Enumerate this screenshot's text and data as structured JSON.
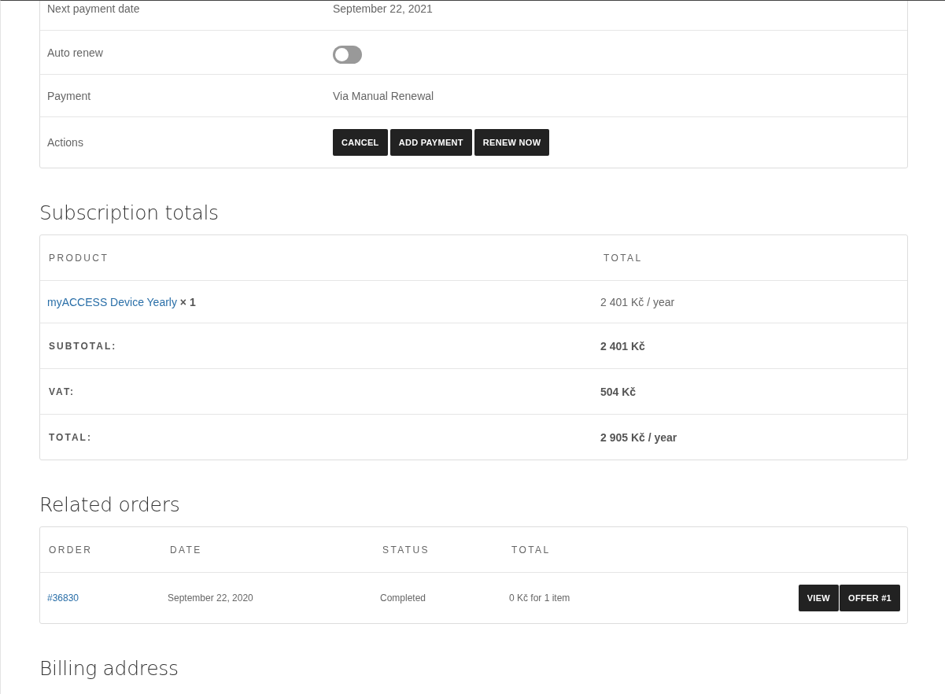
{
  "details": [
    {
      "kind": "text",
      "label": "Next payment date",
      "value": "September 22, 2021"
    },
    {
      "kind": "toggle",
      "label": "Auto renew",
      "on": false
    },
    {
      "kind": "text",
      "label": "Payment",
      "value": "Via Manual Renewal"
    },
    {
      "kind": "actions",
      "label": "Actions",
      "buttons": [
        "CANCEL",
        "ADD PAYMENT",
        "RENEW NOW"
      ]
    }
  ],
  "totals": {
    "title": "Subscription totals",
    "columns": [
      "PRODUCT",
      "TOTAL"
    ],
    "product": {
      "name": "myACCESS Device Yearly",
      "quantity": "× 1",
      "total": "2 401 Kč / year"
    },
    "rows": [
      {
        "label": "SUBTOTAL:",
        "value": "2 401 Kč"
      },
      {
        "label": "VAT:",
        "value": "504 Kč"
      },
      {
        "label": "TOTAL:",
        "value": "2 905 Kč / year"
      }
    ]
  },
  "orders": {
    "title": "Related orders",
    "columns": [
      "ORDER",
      "DATE",
      "STATUS",
      "TOTAL"
    ],
    "rows": [
      {
        "order": "#36830",
        "date": "September 22, 2020",
        "status": "Completed",
        "total": "0 Kč for 1 item",
        "buttons": [
          "VIEW",
          "OFFER #1"
        ]
      }
    ]
  },
  "billing": {
    "title": "Billing address"
  }
}
